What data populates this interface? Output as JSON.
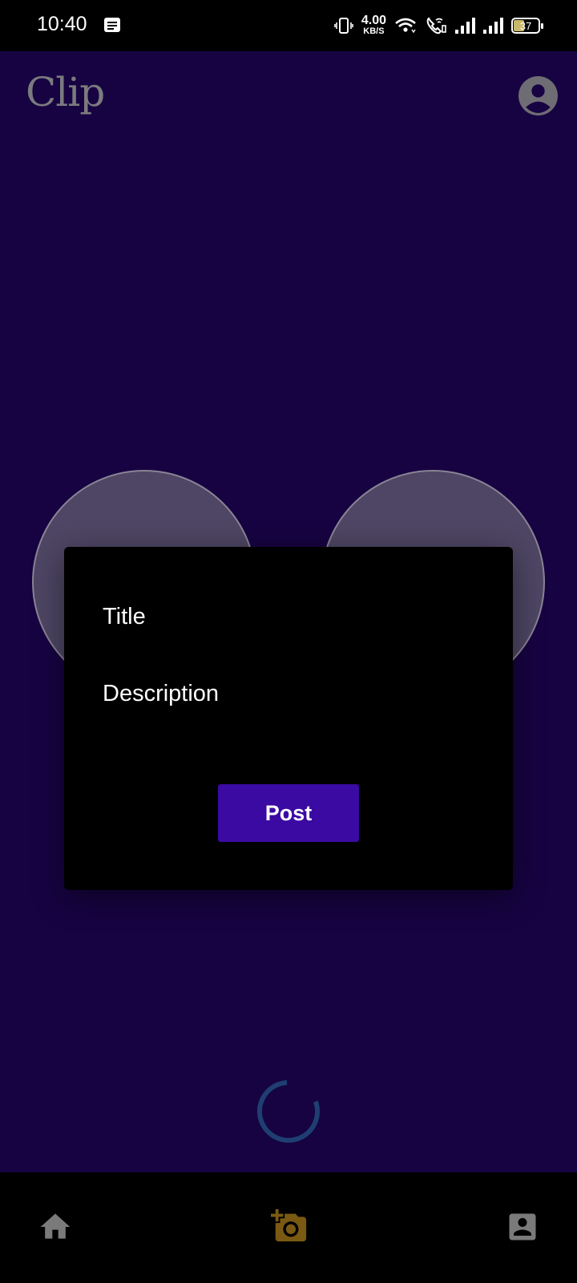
{
  "status_bar": {
    "time": "10:40",
    "net_speed": "4.00",
    "net_unit": "KB/S",
    "battery": "37",
    "icons": [
      "message-icon",
      "vibrate-icon",
      "wifi-icon",
      "wifi-calling-icon",
      "signal-icon",
      "signal-icon",
      "battery-icon"
    ]
  },
  "app_bar": {
    "title": "Clip",
    "account_icon": "account-circle-icon"
  },
  "dialog": {
    "title_label": "Title",
    "description_label": "Description",
    "post_button": "Post"
  },
  "bottom_nav": {
    "items": [
      {
        "icon": "home-icon",
        "color": "#7a7a7a"
      },
      {
        "icon": "add-photo-icon",
        "color": "#7a5a12"
      },
      {
        "icon": "profile-icon",
        "color": "#7a7a7a"
      }
    ]
  },
  "colors": {
    "app_background": "#170342",
    "dialog_background": "#000000",
    "post_button": "#3a0aa2",
    "spinner": "#1f3f73"
  }
}
